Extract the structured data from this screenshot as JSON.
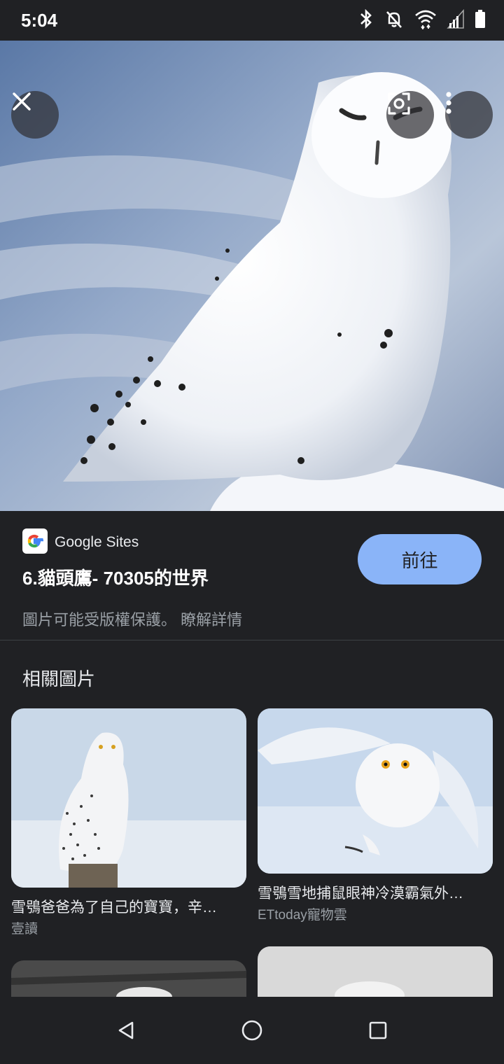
{
  "status_bar": {
    "time": "5:04",
    "icons": [
      "bluetooth-icon",
      "notifications-off-icon",
      "wifi-icon",
      "signal-icon",
      "battery-icon"
    ]
  },
  "viewer": {
    "close_icon": "close-icon",
    "lens_icon": "google-lens-icon",
    "more_icon": "more-vert-icon"
  },
  "result": {
    "source": "Google Sites",
    "title": "6.貓頭鷹- 70305的世界",
    "visit_label": "前往",
    "copyright_notice": "圖片可能受版權保護。",
    "learn_more": "瞭解詳情"
  },
  "related": {
    "heading": "相關圖片",
    "items": [
      {
        "title": "雪鴞爸爸為了自己的寶寶，辛…",
        "source": "壹讀"
      },
      {
        "title": "雪鴞雪地捕鼠眼神冷漠霸氣外…",
        "source": "ETtoday寵物雲"
      }
    ]
  },
  "colors": {
    "background": "#202124",
    "accent": "#8ab4f8",
    "secondary_text": "#9aa0a6"
  }
}
